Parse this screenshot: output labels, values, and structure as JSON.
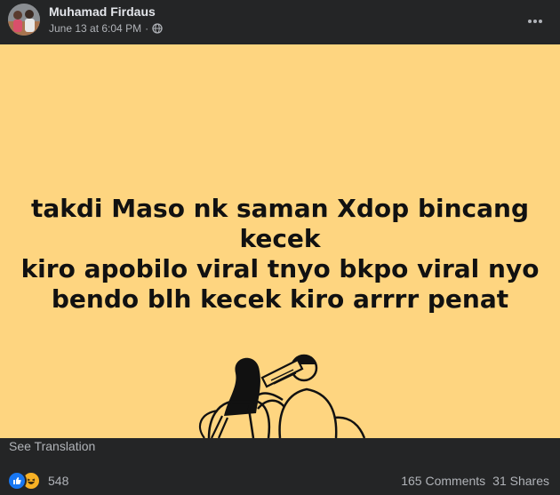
{
  "post": {
    "author": "Muhamad Firdaus",
    "timestamp": "June 13 at 6:04 PM",
    "separator": "·",
    "privacy_icon": "globe-icon",
    "more_icon": "more-horizontal-icon"
  },
  "media": {
    "background": "#fed580",
    "text_lines": [
      "takdi Maso nk saman Xdop bincang kecek",
      "kiro apobilo viral tnyo bkpo viral nyo",
      "bendo blh kecek kiro arrrr penat"
    ]
  },
  "see_translation": "See Translation",
  "footer": {
    "reactions_count": "548",
    "reaction_icons": [
      "like-icon",
      "haha-icon"
    ],
    "comments": "165 Comments",
    "shares": "31 Shares"
  },
  "colors": {
    "page_bg": "#242526",
    "text_primary": "#e4e6eb",
    "text_secondary": "#b0b3b8",
    "like_blue": "#1877f2",
    "haha_yellow": "#f7b125"
  }
}
